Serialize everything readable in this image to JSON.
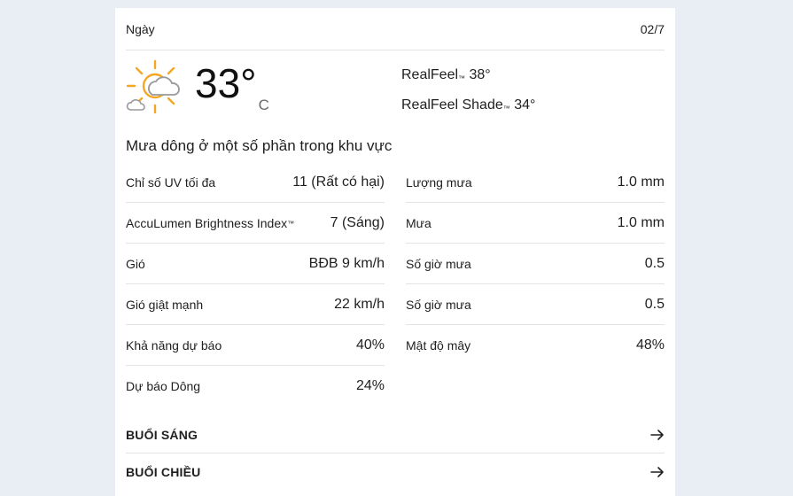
{
  "header": {
    "title": "Ngày",
    "date": "02/7"
  },
  "current": {
    "icon": "partly-sunny-clouds-icon",
    "temperature": "33°",
    "unit": "C",
    "realfeel_label": "RealFeel",
    "realfeel_value": "38°",
    "realfeel_shade_label": "RealFeel Shade",
    "realfeel_shade_value": "34°",
    "trademark": "™"
  },
  "phrase": "Mưa dông ở một số phần trong khu vực",
  "details_left": [
    {
      "label": "Chỉ số UV tối đa",
      "value": "11 (Rất có hại)"
    },
    {
      "label": "AccuLumen Brightness Index",
      "value": "7 (Sáng)"
    },
    {
      "label": "Gió",
      "value": "BĐB 9 km/h"
    },
    {
      "label": "Gió giật mạnh",
      "value": "22 km/h"
    },
    {
      "label": "Khả năng dự báo",
      "value": "40%"
    },
    {
      "label": "Dự báo Dông",
      "value": "24%"
    }
  ],
  "details_right": [
    {
      "label": "Lượng mưa",
      "value": "1.0 mm"
    },
    {
      "label": "Mưa",
      "value": "1.0 mm"
    },
    {
      "label": "Số giờ mưa",
      "value": "0.5"
    },
    {
      "label": "Số giờ mưa",
      "value": "0.5"
    },
    {
      "label": "Mật độ mây",
      "value": "48%"
    }
  ],
  "sections": [
    {
      "label": "BUỔI SÁNG",
      "icon": "arrow-right-icon"
    },
    {
      "label": "BUỔI CHIỀU",
      "icon": "arrow-right-icon"
    }
  ],
  "colors": {
    "sun": "#f5a623",
    "cloud": "#9a9a9a",
    "divider": "#e3e3e3"
  }
}
